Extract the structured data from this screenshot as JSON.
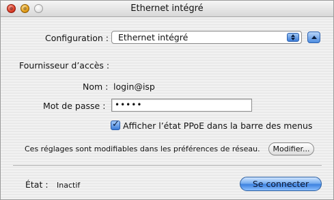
{
  "window": {
    "title": "Ethernet intégré"
  },
  "config": {
    "label": "Configuration :",
    "value": "Ethernet intégré"
  },
  "provider": {
    "section_label": "Fournisseur d’accès :"
  },
  "fields": {
    "name_label": "Nom :",
    "name_value": "login@isp",
    "password_label": "Mot de passe :",
    "password_value": "•••••"
  },
  "checkbox": {
    "label": "Afficher l’état PPoE dans la barre des menus",
    "checked": true
  },
  "note": {
    "text": "Ces réglages sont modifiables dans les préférences de réseau.",
    "button_label": "Modifier..."
  },
  "status": {
    "label": "État :",
    "value": "Inactif"
  },
  "connect_button": {
    "label": "Se connecter"
  }
}
